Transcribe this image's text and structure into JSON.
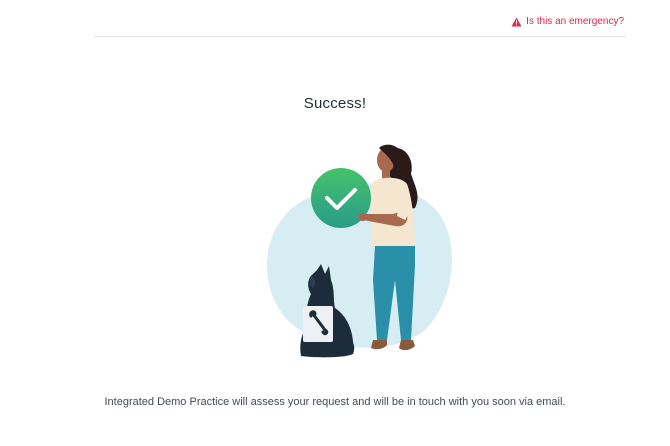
{
  "header": {
    "emergency_link": "Is this an emergency?"
  },
  "main": {
    "title": "Success!",
    "message": "Integrated Demo Practice will assess your request and will be in touch with you soon via email."
  },
  "icons": {
    "warning": "warning-triangle-icon",
    "check": "checkmark-icon",
    "bone": "bone-icon"
  },
  "colors": {
    "alert_red": "#e0284f",
    "blob_blue": "#d6edf3",
    "check_green_top": "#3fbf6b",
    "check_green_bottom": "#2a9c8a",
    "pants_teal": "#2a8fa8",
    "dog_navy": "#1d2c3a"
  }
}
